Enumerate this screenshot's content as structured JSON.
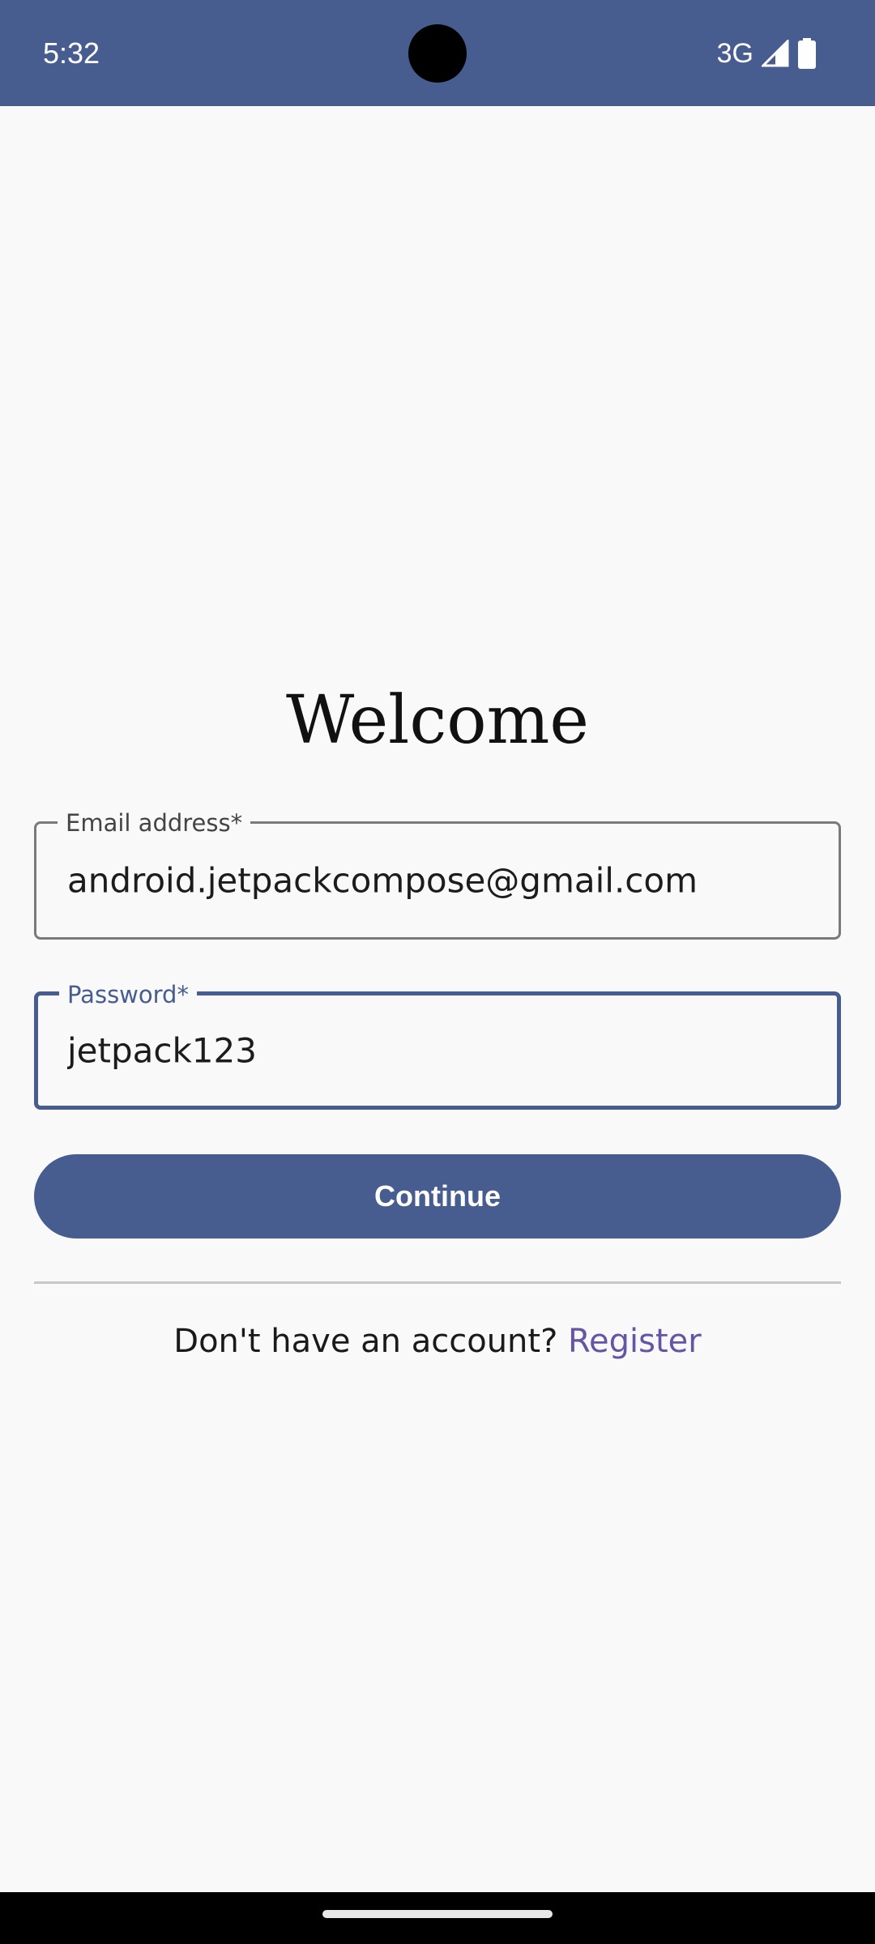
{
  "status_bar": {
    "time": "5:32",
    "network": "3G",
    "icons": [
      "signal-icon",
      "battery-icon"
    ],
    "background_color": "#475c8f"
  },
  "form": {
    "title": "Welcome",
    "email_label": "Email address*",
    "email_value": "android.jetpackcompose@gmail.com",
    "password_label": "Password*",
    "password_value": "jetpack123",
    "continue_label": "Continue",
    "register_prompt": "Don't have an account? ",
    "register_link": "Register"
  },
  "colors": {
    "primary": "#475c8f",
    "link": "#6655a6",
    "background": "#f9f9f9"
  }
}
